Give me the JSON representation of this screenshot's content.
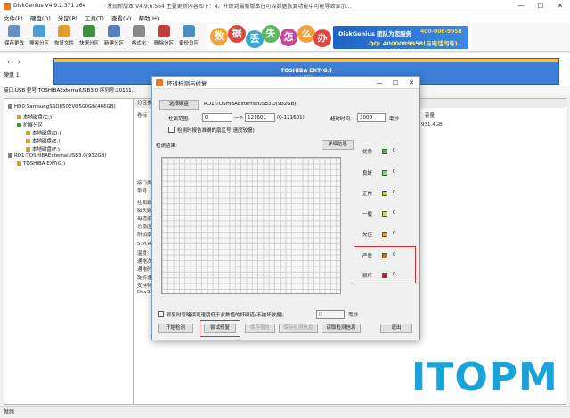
{
  "titlebar": {
    "title": "DiskGenius V4.9.2.371 x64",
    "notice": "· 发现新版本 V4.9.6.564 主要更新内容如下：4、升级到最新版本在可靠数据恢复功能中可能导致显示...",
    "minimize": "—",
    "maximize": "☐",
    "close": "✕"
  },
  "menu": [
    "文件(F)",
    "硬盘(D)",
    "分区(P)",
    "工具(T)",
    "查看(V)",
    "帮助(H)"
  ],
  "toolbar": [
    {
      "label": "保存更改",
      "icon": "save-icon",
      "color": "#6a8fc7"
    },
    {
      "label": "搜索分区",
      "icon": "search-partition-icon",
      "color": "#4a9fd8"
    },
    {
      "label": "恢复文件",
      "icon": "recover-file-icon",
      "color": "#e0a030"
    },
    {
      "label": "快速分区",
      "icon": "quick-partition-icon",
      "color": "#3f8f3f"
    },
    {
      "label": "新建分区",
      "icon": "new-partition-icon",
      "color": "#5a7fbf"
    },
    {
      "label": "格式化",
      "icon": "format-icon",
      "color": "#888888"
    },
    {
      "label": "删除分区",
      "icon": "delete-partition-icon",
      "color": "#c04040"
    },
    {
      "label": "备份分区",
      "icon": "backup-partition-icon",
      "color": "#4a8fc0"
    }
  ],
  "banner": {
    "chars": [
      {
        "text": "数",
        "color": "#f2a23a"
      },
      {
        "text": "据",
        "color": "#e0463e"
      },
      {
        "text": "丢",
        "color": "#38a8d0"
      },
      {
        "text": "失",
        "color": "#5cb85c"
      },
      {
        "text": "怎",
        "color": "#c44a9c"
      },
      {
        "text": "么",
        "color": "#f2a23a"
      },
      {
        "text": "办",
        "color": "#e0463e"
      }
    ],
    "promo_line1": "DiskGenius 团队为您服务",
    "promo_phone": "400-008-9958",
    "promo_qq": "QQ: 4000089958(与电话同号)"
  },
  "diskbar": {
    "prev": "‹",
    "next": "›",
    "disk_label": "硬盘 1",
    "partition_name": "TOSHIBA EXT(G:)",
    "partition_fs": "NTFS"
  },
  "infobar": "接口:USB  型号:TOSHIBAExternalUSB3.0  序列号:20161...",
  "tree": [
    {
      "text": "HD0:SamsungSSD850EVO500GB(466GB)",
      "color": "#7f7f7f"
    },
    {
      "text": "本地磁盘(C:)",
      "color": "#d4a017"
    },
    {
      "text": "扩展分区",
      "color": "#3f8f3f"
    },
    {
      "text": "本地磁盘(D:)",
      "color": "#d4a017"
    },
    {
      "text": "本地磁盘(E:)",
      "color": "#d4a017"
    },
    {
      "text": "本地磁盘(F:)",
      "color": "#d4a017"
    },
    {
      "text": "RD1:TOSHIBAExternalUSB3.0(932GB)",
      "color": "#7f7f7f"
    },
    {
      "text": "TOSHIBA EXT(G:)",
      "color": "#d4a017"
    }
  ],
  "rightpanel": {
    "tab": "分区参数",
    "col_label": "卷标",
    "col_capacity": "容量",
    "capacity_value": "931.4GB",
    "side_labels": [
      "接口类",
      "型号",
      "柱面数",
      "磁头数",
      "每道扇",
      "总扇区",
      "附加扇",
      "S.M.A",
      "温度:",
      "通电次",
      "通电时",
      "旋转速",
      "支持特",
      "DevSl"
    ]
  },
  "dialog": {
    "title": "坏道检测与修复",
    "select_disk_btn": "选择硬盘",
    "disk_name": "RD1:TOSHIBAExternalUSB3.0(932GB)",
    "cyl_range_label": "柱面范围:",
    "cyl_from": "0",
    "arrow": "—>",
    "cyl_to": "121601",
    "cyl_hint": "(0-121601)",
    "timeout_label": "超时时间:",
    "timeout_value": "3000",
    "timeout_unit": "毫秒",
    "report_check_label": "检测时报告准确的扇区号(速度较慢)",
    "result_label": "检测结果:",
    "detail_btn": "详细信息",
    "legend": [
      {
        "label": "优秀",
        "color": "#58b05a",
        "count": "0"
      },
      {
        "label": "良好",
        "color": "#8ed08a",
        "count": "0"
      },
      {
        "label": "正常",
        "color": "#c9c04a",
        "count": "0"
      },
      {
        "label": "一般",
        "color": "#e6d24a",
        "count": "0"
      },
      {
        "label": "欠佳",
        "color": "#f0a020",
        "count": "0"
      },
      {
        "label": "严重",
        "color": "#c0701a",
        "count": "0"
      },
      {
        "label": "损坏",
        "color": "#b02020",
        "count": "0"
      }
    ],
    "skip_label": "修复时忽略读写速度低于此数值的好磁道(不被坏数据)",
    "skip_value": "0",
    "skip_unit": "毫秒",
    "buttons": {
      "start": "开始检测",
      "repair": "尝试修复",
      "save_report": "保存报告",
      "save_info": "保存检测信息",
      "read_info": "读取检测信息",
      "exit": "退出"
    }
  },
  "statusbar": "就绪",
  "watermark": "ITOPM",
  "colors": {
    "accent": "#3d7fd6",
    "highlight": "#d32f2f"
  }
}
